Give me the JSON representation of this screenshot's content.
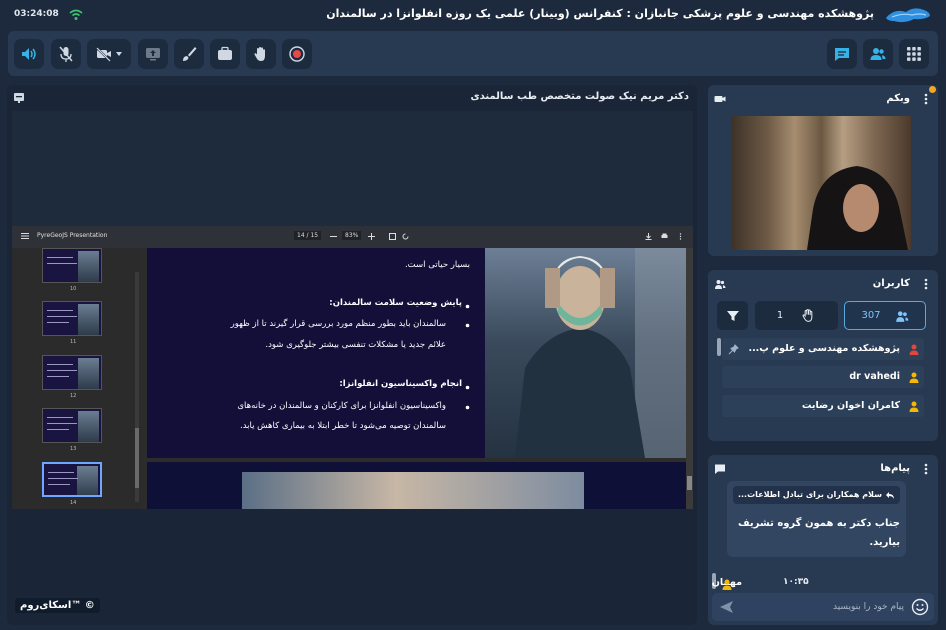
{
  "status": {
    "time": "03:24:08",
    "wifi_icon": "wifi-icon"
  },
  "conference": {
    "title": "پژوهشکده مهندسی و علوم پزشکی جانبازان : کنفرانس (وبینار) علمی یک روزه انفلوانزا در سالمندان"
  },
  "toolbar": {
    "buttons": [
      "speaker-icon",
      "mic-muted-icon",
      "camera-off-icon",
      "screen-share-icon",
      "brush-icon",
      "briefcase-icon",
      "raise-hand-icon",
      "record-icon",
      "chat-icon",
      "users-icon",
      "apps-grid-icon"
    ],
    "accent": "#36b3e6"
  },
  "presentation": {
    "title": "دکتر مریم نیک صولت متخصص طب سالمندی",
    "viewer": {
      "app_name": "PyreGeoJS Presentation",
      "page_label": "14 / 15",
      "zoom_label": "83%",
      "thumb_labels": [
        "10",
        "11",
        "12",
        "13",
        "14"
      ]
    },
    "slide": {
      "line0": "بسیار حیاتی است.",
      "head1": "پایش وضعیت سلامت سالمندان:",
      "line1a": "سالمندان باید بطور منظم مورد بررسی قرار گیرند تا از ظهور",
      "line1b": "علائم جدید یا مشکلات تنفسی بیشتر جلوگیری شود.",
      "head2": "انجام واکسیناسیون انفلوانزا:",
      "line2a": "واکسیناسیون انفلوانزا برای کارکنان و سالمندان در خانه‌های",
      "line2b": "سالمندان توصیه می‌شود تا خطر ابتلا به بیماری کاهش یابد."
    },
    "brand": "اسکای‌روم™ ©"
  },
  "webcam": {
    "title": "وبکم"
  },
  "users": {
    "title": "کاربران",
    "count": "307",
    "hands": "1",
    "list": [
      {
        "name": "پژوهشکده مهندسی و علوم پ...",
        "color": "#e0473d"
      },
      {
        "name": "dr vahedi",
        "color": "#f5b700"
      },
      {
        "name": "کامران اخوان رضایت",
        "color": "#f5b700"
      }
    ]
  },
  "chat": {
    "title": "پیام‌ها",
    "reply_preview": "سلام همکاران برای تبادل اطلاعات...",
    "message": "جناب دکتر به همون گروه تشریف بیارید.",
    "sender": "مهمان",
    "time": "۱۰:۳۵",
    "input_placeholder": "پیام خود را بنویسید"
  }
}
